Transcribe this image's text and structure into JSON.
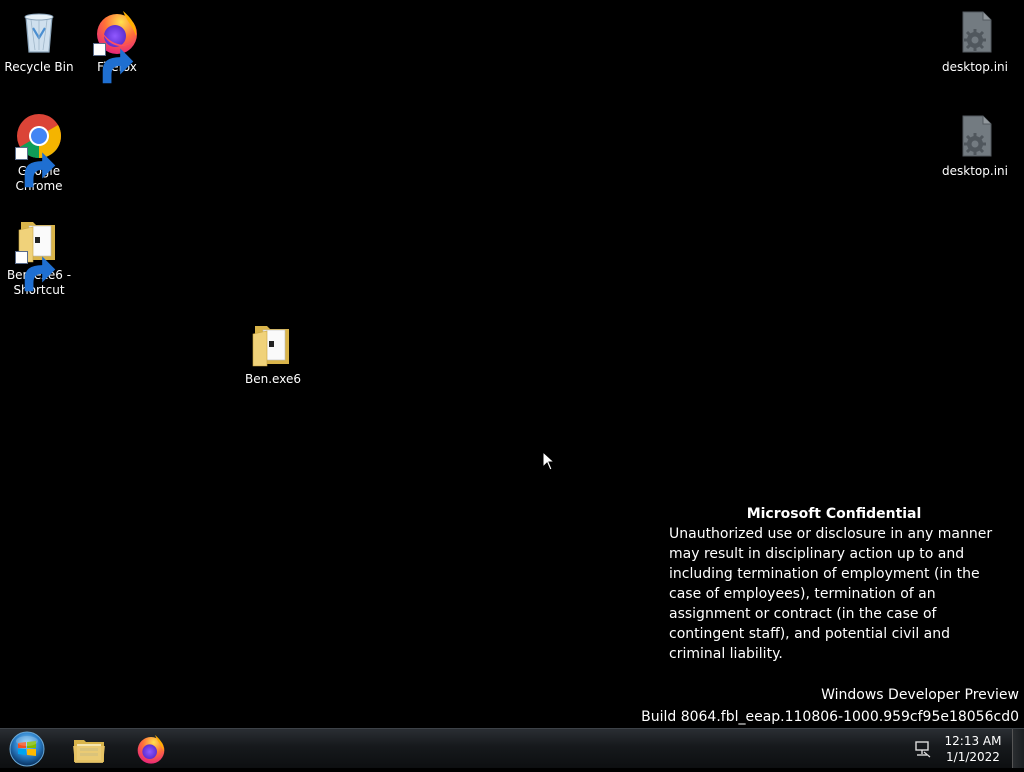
{
  "desktop": {
    "icons": [
      {
        "label": "Recycle Bin",
        "icon": "recycle-bin-icon"
      },
      {
        "label": "Firefox",
        "icon": "firefox-icon",
        "shortcut": true
      },
      {
        "label": "Google Chrome",
        "icon": "chrome-icon",
        "shortcut": true
      },
      {
        "label": "Ben.exe6 - Shortcut",
        "icon": "folder-icon",
        "shortcut": true
      },
      {
        "label": "Ben.exe6",
        "icon": "folder-icon"
      },
      {
        "label": "desktop.ini",
        "icon": "settings-file-icon"
      },
      {
        "label": "desktop.ini",
        "icon": "settings-file-icon"
      }
    ]
  },
  "watermark": {
    "title": "Microsoft Confidential",
    "body": "Unauthorized use or disclosure in any manner may result in disciplinary action up to and including termination of employment (in the case of employees), termination of an assignment or contract (in the case of contingent staff), and potential civil and criminal liability.",
    "edition": "Windows Developer Preview",
    "build": "Build 8064.fbl_eeap.110806-1000.959cf95e18056cd0"
  },
  "taskbar": {
    "apps": [
      {
        "name": "File Explorer",
        "icon": "file-explorer-icon"
      },
      {
        "name": "Firefox",
        "icon": "firefox-icon"
      }
    ],
    "clock": {
      "time": "12:13 AM",
      "date": "1/1/2022"
    }
  },
  "colors": {
    "desktop_bg": "#000000",
    "text": "#ffffff",
    "folder": "#e8c66a",
    "firefox_orange": "#ff7139",
    "firefox_purple": "#7542e5"
  }
}
